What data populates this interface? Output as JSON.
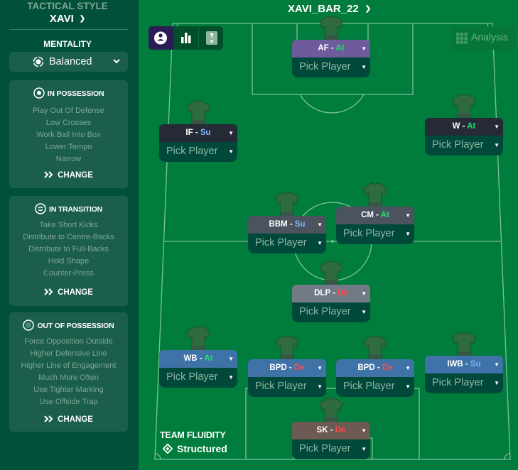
{
  "sidebar": {
    "tactical_style_label": "TACTICAL STYLE",
    "tactical_style_value": "XAVI",
    "mentality_label": "MENTALITY",
    "mentality_value": "Balanced",
    "panels": [
      {
        "title": "IN POSSESSION",
        "icon": "ball-icon",
        "items": [
          "Play Out Of Defense",
          "Low Crosses",
          "Work Ball Into Box",
          "Lower Tempo",
          "Narrow"
        ],
        "change_label": "CHANGE"
      },
      {
        "title": "IN TRANSITION",
        "icon": "transition-icon",
        "items": [
          "Take Short Kicks",
          "Distribute to Centre-Backs",
          "Distribute to Full-Backs",
          "Hold Shape",
          "Counter-Press"
        ],
        "change_label": "CHANGE"
      },
      {
        "title": "OUT OF POSSESSION",
        "icon": "out-of-possession-icon",
        "items": [
          "Force Opposition Outside",
          "Higher Defensive Line",
          "Higher Line of Engagement",
          "Much More Often",
          "Use Tighter Marking",
          "Use Offside Trap"
        ],
        "change_label": "CHANGE"
      }
    ]
  },
  "header": {
    "tactic_name": "XAVI_BAR_22",
    "analysis_label": "Analysis",
    "view_buttons": [
      "player-view-icon",
      "stats-view-icon",
      "instructions-view-icon"
    ]
  },
  "colors": {
    "pitch": "#007d3c",
    "sidebar": "#01513a",
    "attack_duty": "#1fe06a",
    "support_duty": "#7cb6ff",
    "defend_duty": "#ff4a4a"
  },
  "positions": [
    {
      "id": "af",
      "role": "AF",
      "duty": "At",
      "pick": "Pick Player"
    },
    {
      "id": "if",
      "role": "IF",
      "duty": "Su",
      "pick": "Pick Player"
    },
    {
      "id": "w",
      "role": "W",
      "duty": "At",
      "pick": "Pick Player"
    },
    {
      "id": "bbm",
      "role": "BBM",
      "duty": "Su",
      "pick": "Pick Player"
    },
    {
      "id": "cm",
      "role": "CM",
      "duty": "At",
      "pick": "Pick Player"
    },
    {
      "id": "dlp",
      "role": "DLP",
      "duty": "De",
      "pick": "Pick Player"
    },
    {
      "id": "wb",
      "role": "WB",
      "duty": "At",
      "pick": "Pick Player"
    },
    {
      "id": "bpd1",
      "role": "BPD",
      "duty": "De",
      "pick": "Pick Player"
    },
    {
      "id": "bpd2",
      "role": "BPD",
      "duty": "De",
      "pick": "Pick Player"
    },
    {
      "id": "iwb",
      "role": "IWB",
      "duty": "Su",
      "pick": "Pick Player"
    },
    {
      "id": "sk",
      "role": "SK",
      "duty": "De",
      "pick": "Pick Player"
    }
  ],
  "team_fluidity": {
    "label": "TEAM FLUIDITY",
    "value": "Structured"
  }
}
